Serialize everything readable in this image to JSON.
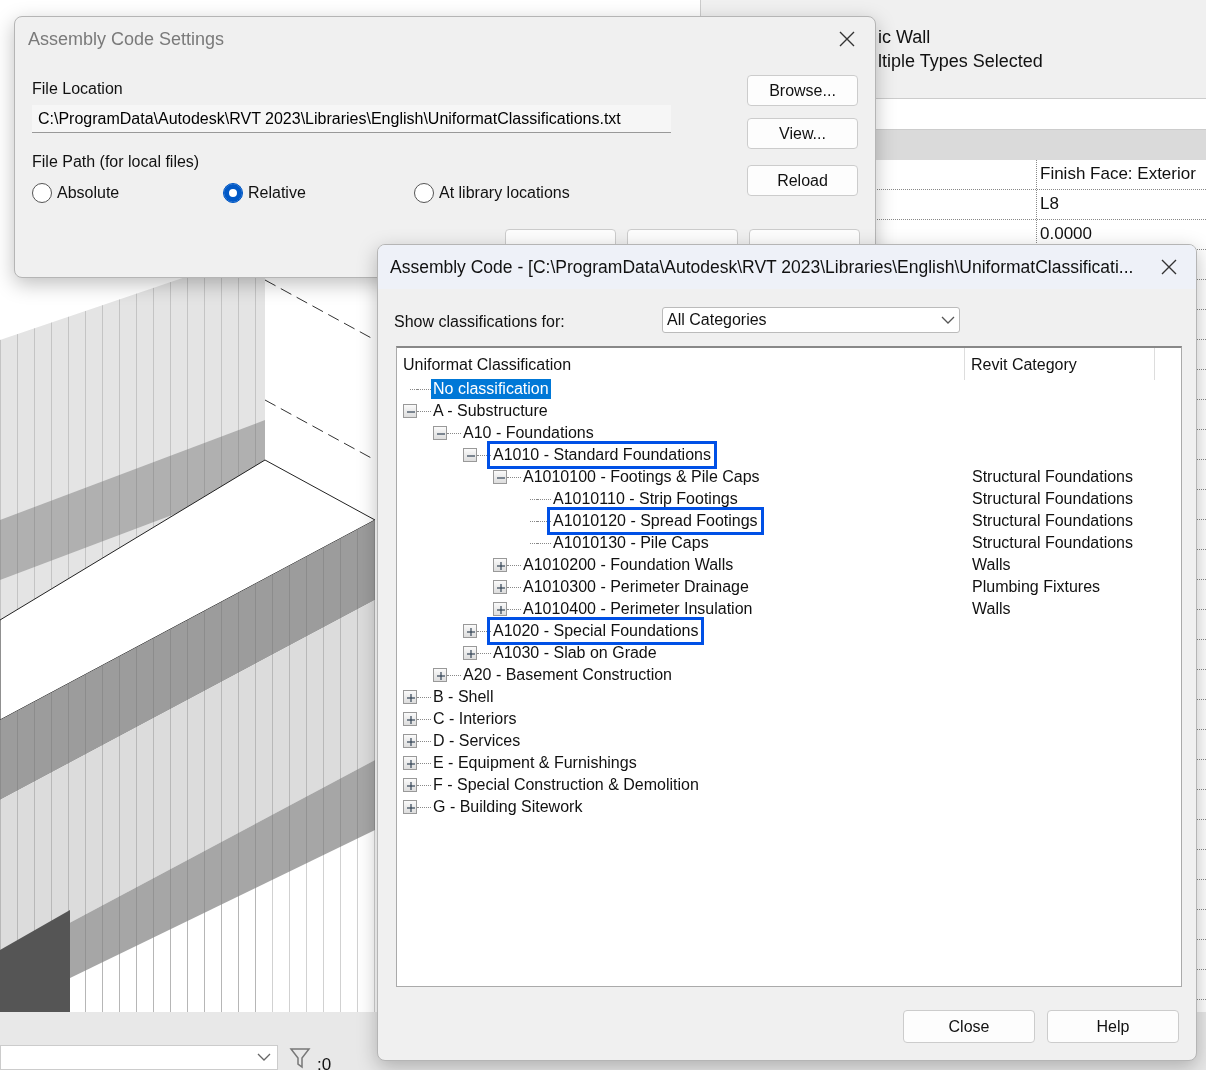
{
  "properties_panel": {
    "type_name": "ic Wall",
    "type_subtitle": "ltiple Types Selected",
    "rows": [
      {
        "value": "Finish Face: Exterior"
      },
      {
        "value": "L8"
      },
      {
        "value": "0.0000"
      }
    ]
  },
  "status_bar": {
    "counter": ":0"
  },
  "settings_dialog": {
    "title": "Assembly Code Settings",
    "active": false,
    "file_location_label": "File Location",
    "file_location": "C:\\ProgramData\\Autodesk\\RVT 2023\\Libraries\\English\\UniformatClassifications.txt",
    "file_path_label": "File Path (for local files)",
    "options": [
      {
        "label": "Absolute",
        "selected": false
      },
      {
        "label": "Relative",
        "selected": true
      },
      {
        "label": "At library locations",
        "selected": false
      }
    ],
    "side_buttons": [
      "Browse...",
      "View...",
      "Reload"
    ]
  },
  "assembly_dialog": {
    "title": "Assembly Code - [C:\\ProgramData\\Autodesk\\RVT 2023\\Libraries\\English\\UniformatClassificati...",
    "show_label": "Show classifications for:",
    "show_value": "All Categories",
    "columns": [
      "Uniformat Classification",
      "Revit Category"
    ],
    "tree": [
      {
        "label": "No classification",
        "selected": true,
        "highlighted": false
      },
      {
        "label": "A - Substructure",
        "expanded": true,
        "selected": false,
        "highlighted": false,
        "children": [
          {
            "label": "A10 - Foundations",
            "expanded": true,
            "selected": false,
            "highlighted": false,
            "children": [
              {
                "label": "A1010 - Standard Foundations",
                "expanded": true,
                "selected": false,
                "highlighted": true,
                "children": [
                  {
                    "label": "A1010100 - Footings & Pile Caps",
                    "expanded": true,
                    "selected": false,
                    "highlighted": false,
                    "category": "Structural Foundations",
                    "children": [
                      {
                        "label": "A1010110 - Strip Footings",
                        "selected": false,
                        "highlighted": false,
                        "category": "Structural Foundations"
                      },
                      {
                        "label": "A1010120 - Spread Footings",
                        "selected": false,
                        "highlighted": true,
                        "category": "Structural Foundations"
                      },
                      {
                        "label": "A1010130 - Pile Caps",
                        "selected": false,
                        "highlighted": false,
                        "category": "Structural Foundations"
                      }
                    ]
                  },
                  {
                    "label": "A1010200 - Foundation Walls",
                    "expanded": false,
                    "selected": false,
                    "highlighted": false,
                    "category": "Walls"
                  },
                  {
                    "label": "A1010300 - Perimeter Drainage",
                    "expanded": false,
                    "selected": false,
                    "highlighted": false,
                    "category": "Plumbing Fixtures"
                  },
                  {
                    "label": "A1010400 - Perimeter Insulation",
                    "expanded": false,
                    "selected": false,
                    "highlighted": false,
                    "category": "Walls"
                  }
                ]
              },
              {
                "label": "A1020 - Special Foundations",
                "expanded": false,
                "selected": false,
                "highlighted": true
              },
              {
                "label": "A1030 - Slab on Grade",
                "expanded": false,
                "selected": false,
                "highlighted": false
              }
            ]
          },
          {
            "label": "A20 - Basement Construction",
            "expanded": false,
            "selected": false,
            "highlighted": false
          }
        ]
      },
      {
        "label": "B - Shell",
        "expanded": false,
        "selected": false,
        "highlighted": false
      },
      {
        "label": "C - Interiors",
        "expanded": false,
        "selected": false,
        "highlighted": false
      },
      {
        "label": "D - Services",
        "expanded": false,
        "selected": false,
        "highlighted": false
      },
      {
        "label": "E - Equipment & Furnishings",
        "expanded": false,
        "selected": false,
        "highlighted": false
      },
      {
        "label": "F - Special Construction & Demolition",
        "expanded": false,
        "selected": false,
        "highlighted": false
      },
      {
        "label": "G - Building Sitework",
        "expanded": false,
        "selected": false,
        "highlighted": false
      }
    ],
    "buttons": [
      "Close",
      "Help"
    ]
  }
}
